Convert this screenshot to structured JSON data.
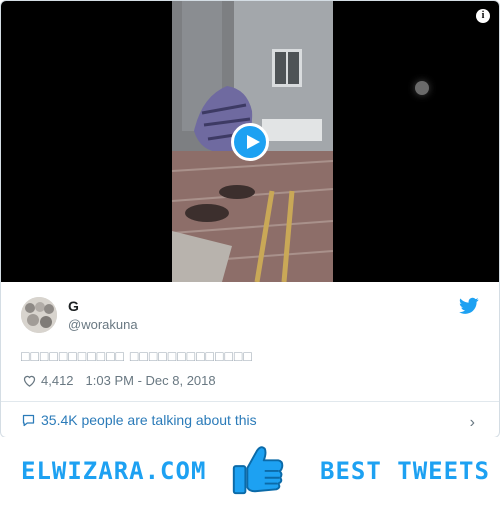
{
  "tweet": {
    "author_name": "G",
    "author_handle": "@worakuna",
    "text": "□□□□□□□□□□□ □□□□□□□□□□□□□",
    "likes": "4,412",
    "timestamp": "1:03 PM - Dec 8, 2018",
    "talking": "35.4K people are talking about this",
    "icons": {
      "info": "info-icon",
      "play": "play-icon",
      "bird": "twitter-bird-icon",
      "heart": "heart-icon",
      "comment": "comment-bubble-icon",
      "chevron": "chevron-right-icon"
    }
  },
  "banner": {
    "site": "ELWIZARA.COM",
    "tagline": "BEST TWEETS",
    "accent": "#1da1f2"
  },
  "colors": {
    "link": "#2b7bb9",
    "muted": "#697882",
    "text": "#1c2022"
  }
}
